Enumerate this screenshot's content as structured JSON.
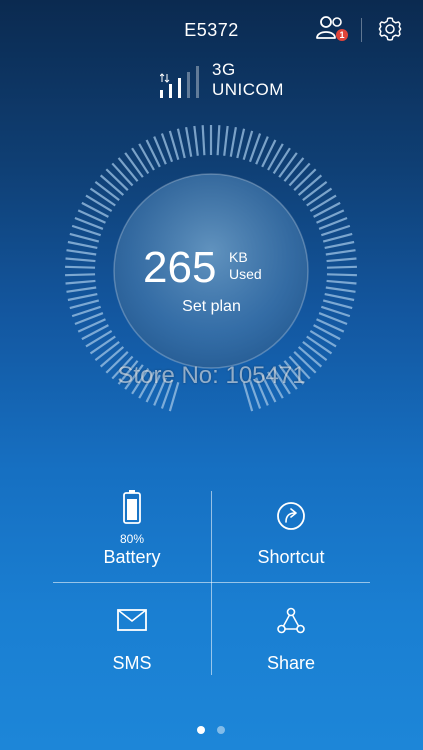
{
  "header": {
    "device_name": "E5372",
    "notification_count": "1"
  },
  "network": {
    "type": "3G",
    "operator": "UNICOM"
  },
  "usage": {
    "value": "265",
    "unit": "KB",
    "label": "Used",
    "set_plan": "Set plan"
  },
  "watermark": "Store No: 105471",
  "tiles": {
    "battery": {
      "percent": "80%",
      "label": "Battery",
      "level": 0.8
    },
    "shortcut": {
      "label": "Shortcut"
    },
    "sms": {
      "label": "SMS"
    },
    "share": {
      "label": "Share"
    }
  },
  "pager": {
    "current_page": 1,
    "total_pages": 2
  },
  "colors": {
    "badge": "#e0443a",
    "accent": "#ffffff",
    "tick": "#9fc4e6"
  },
  "icons": [
    "users-icon",
    "gear-icon",
    "signal-icon",
    "battery-icon",
    "shortcut-icon",
    "mail-icon",
    "share-icon"
  ]
}
